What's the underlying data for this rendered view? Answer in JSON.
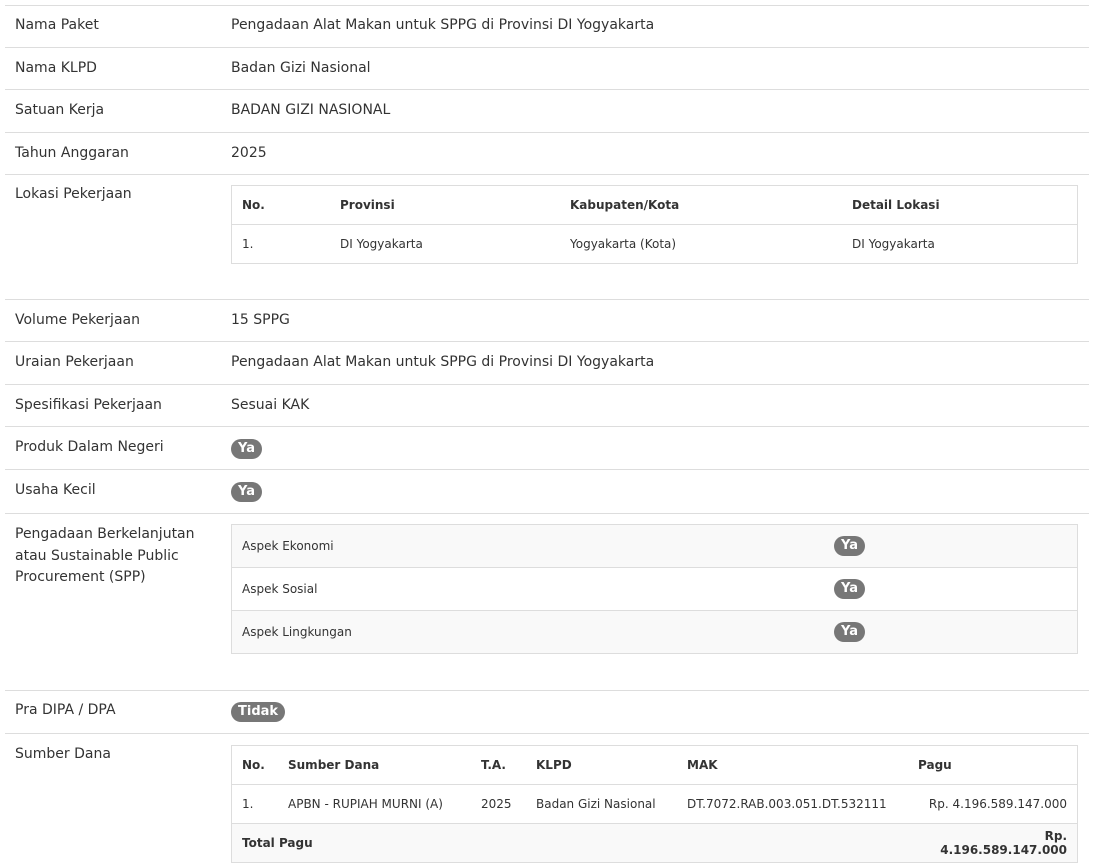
{
  "rows": {
    "nama_paket": {
      "label": "Nama Paket",
      "value": "Pengadaan Alat Makan untuk SPPG di Provinsi DI Yogyakarta"
    },
    "nama_klpd": {
      "label": "Nama KLPD",
      "value": "Badan Gizi Nasional"
    },
    "satuan_kerja": {
      "label": "Satuan Kerja",
      "value": "BADAN GIZI NASIONAL"
    },
    "tahun_anggaran": {
      "label": "Tahun Anggaran",
      "value": "2025"
    },
    "lokasi": {
      "label": "Lokasi Pekerjaan"
    },
    "volume": {
      "label": "Volume Pekerjaan",
      "value": "15 SPPG"
    },
    "uraian": {
      "label": "Uraian Pekerjaan",
      "value": "Pengadaan Alat Makan untuk SPPG di Provinsi DI Yogyakarta"
    },
    "spesifikasi": {
      "label": "Spesifikasi Pekerjaan",
      "value": "Sesuai KAK"
    },
    "pdn": {
      "label": "Produk Dalam Negeri",
      "badge": "Ya"
    },
    "usaha_kecil": {
      "label": "Usaha Kecil",
      "badge": "Ya"
    },
    "spp": {
      "label_lines": [
        "Pengadaan Berkelanjutan",
        "atau Sustainable Public",
        "Procurement (SPP)"
      ]
    },
    "pra_dipa": {
      "label": "Pra DIPA / DPA",
      "badge": "Tidak"
    },
    "sumber_dana": {
      "label": "Sumber Dana"
    }
  },
  "lokasi_table": {
    "headers": [
      "No.",
      "Provinsi",
      "Kabupaten/Kota",
      "Detail Lokasi"
    ],
    "rows": [
      [
        "1.",
        "DI Yogyakarta",
        "Yogyakarta (Kota)",
        "DI Yogyakarta"
      ]
    ]
  },
  "spp_table": {
    "rows": [
      {
        "aspek": "Aspek Ekonomi",
        "badge": "Ya"
      },
      {
        "aspek": "Aspek Sosial",
        "badge": "Ya"
      },
      {
        "aspek": "Aspek Lingkungan",
        "badge": "Ya"
      }
    ]
  },
  "dana_table": {
    "headers": [
      "No.",
      "Sumber Dana",
      "T.A.",
      "KLPD",
      "MAK",
      "Pagu"
    ],
    "rows": [
      [
        "1.",
        "APBN - RUPIAH MURNI (A)",
        "2025",
        "Badan Gizi Nasional",
        "DT.7072.RAB.003.051.DT.532111",
        "Rp. 4.196.589.147.000"
      ]
    ],
    "total_label": "Total Pagu",
    "total_value": "Rp. 4.196.589.147.000"
  }
}
